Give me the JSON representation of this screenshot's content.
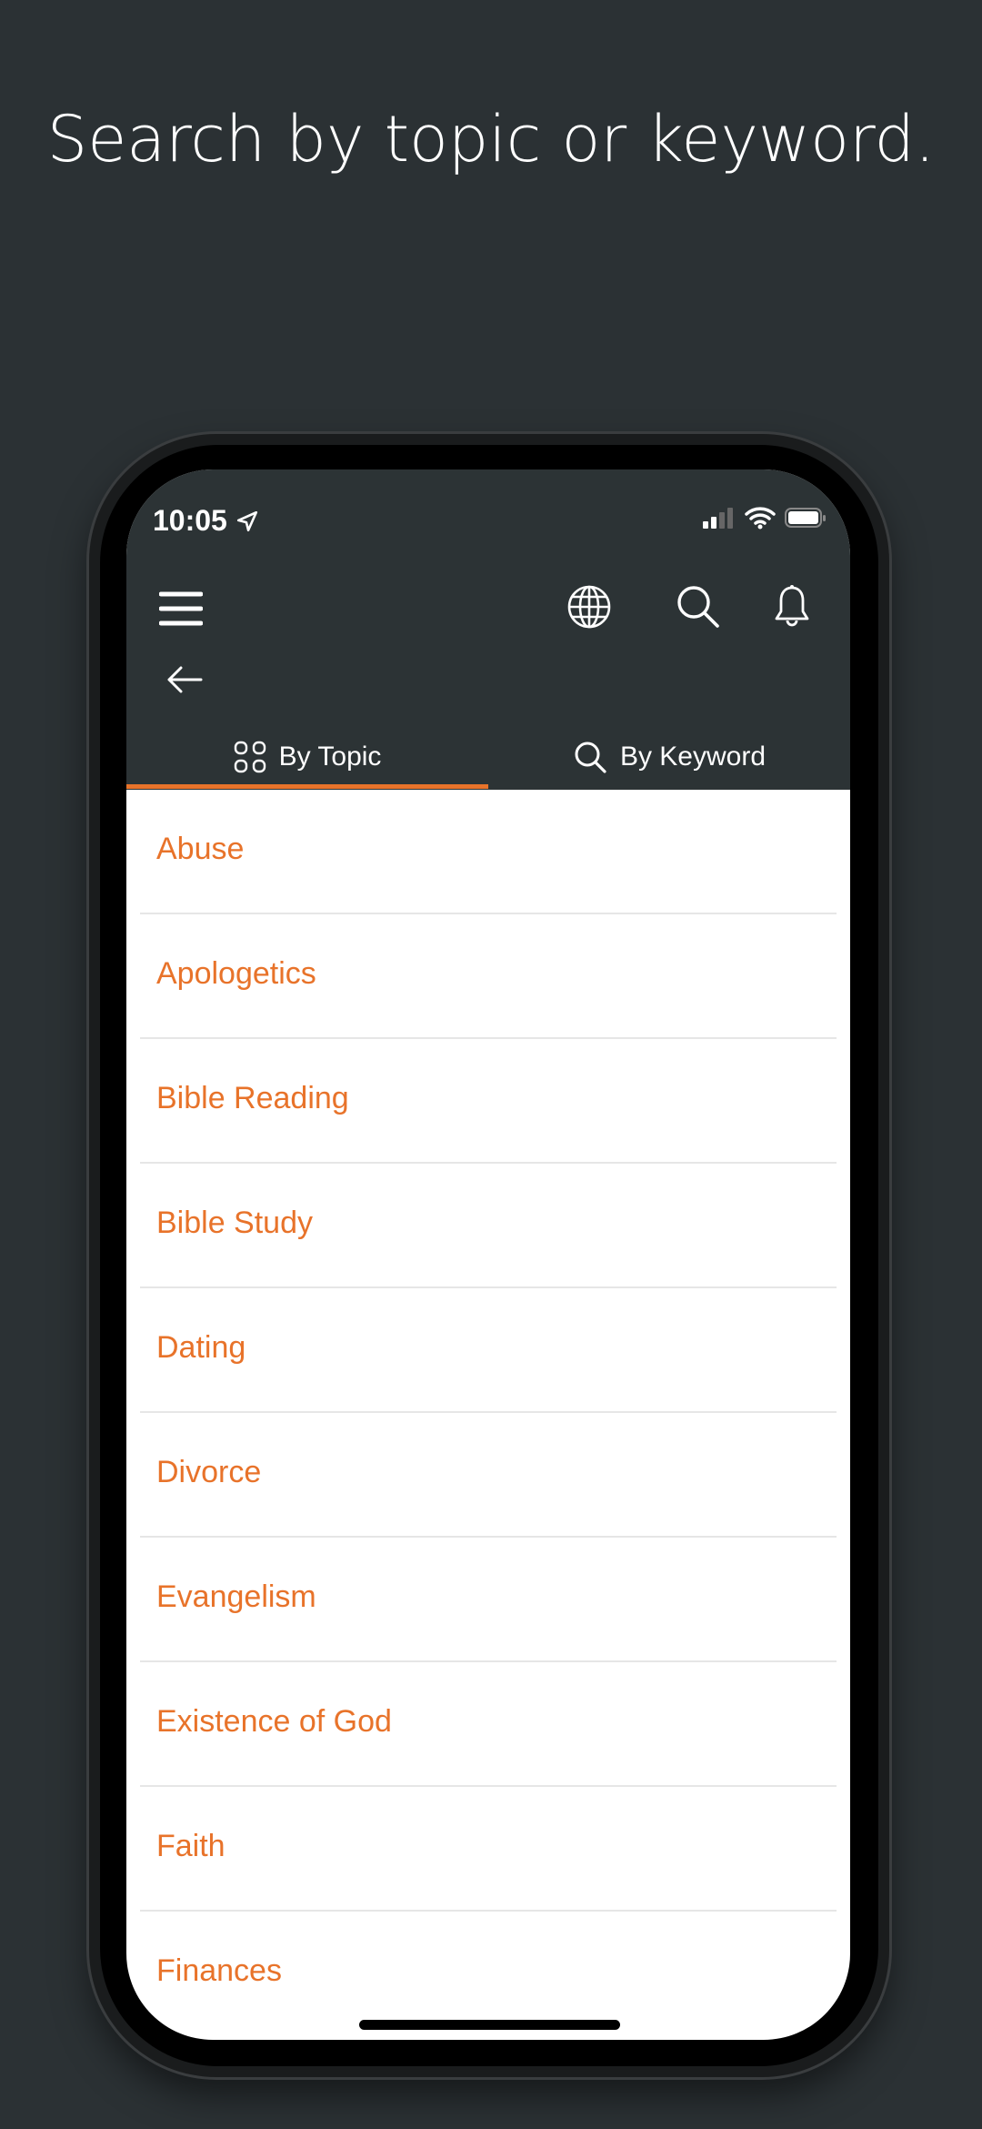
{
  "headline": "Search by topic or keyword.",
  "status_bar": {
    "time": "10:05"
  },
  "tabs": [
    {
      "label": "By Topic",
      "icon": "grid-icon",
      "active": true
    },
    {
      "label": "By Keyword",
      "icon": "search-icon",
      "active": false
    }
  ],
  "topics": [
    "Abuse",
    "Apologetics",
    "Bible Reading",
    "Bible Study",
    "Dating",
    "Divorce",
    "Evangelism",
    "Existence of God",
    "Faith",
    "Finances"
  ],
  "colors": {
    "accent": "#e8732a",
    "header": "#2c3335",
    "background": "#2b3134"
  }
}
